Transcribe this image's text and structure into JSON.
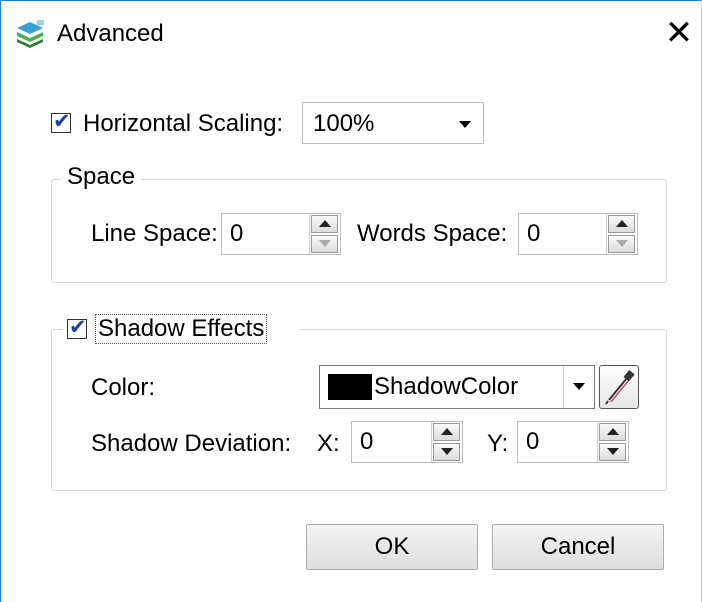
{
  "window": {
    "title": "Advanced",
    "close_glyph": "✕",
    "app_icon": "layers-icon"
  },
  "scaling": {
    "checked": true,
    "label": "Horizontal Scaling:",
    "value": "100%"
  },
  "space": {
    "legend": "Space",
    "line_space_label": "Line Space:",
    "line_space_value": "0",
    "words_space_label": "Words Space:",
    "words_space_value": "0"
  },
  "shadow": {
    "checked": true,
    "legend": "Shadow Effects",
    "color_label": "Color:",
    "color_value": "ShadowColor",
    "color_swatch": "#000000",
    "picker_icon": "eyedropper-icon",
    "deviation_label": "Shadow Deviation:",
    "x_label": "X:",
    "x_value": "0",
    "y_label": "Y:",
    "y_value": "0"
  },
  "buttons": {
    "ok": "OK",
    "cancel": "Cancel"
  },
  "colors": {
    "window_border": "#1a7fd4",
    "check_mark": "#1f3fa8"
  }
}
